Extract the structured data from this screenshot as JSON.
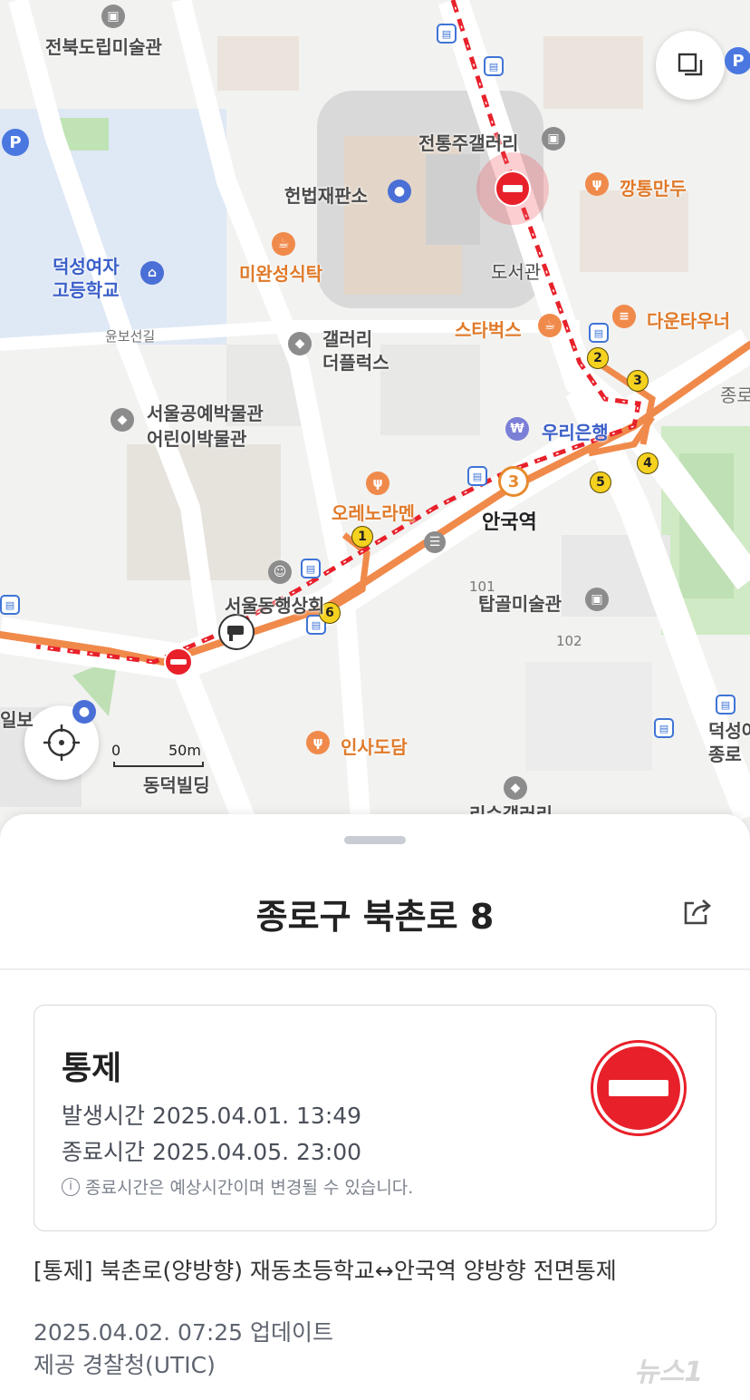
{
  "map": {
    "labels": {
      "museum_jeonbuk": "전북도립미술관",
      "gallery_jeontong": "전통주갤러리",
      "constitutional_court": "헌법재판소",
      "kkangtong": "깡통만두",
      "deoksung_girls_1": "덕성여자",
      "deoksung_girls_2": "고등학교",
      "mianseong": "미완성식탁",
      "library": "도서관",
      "starbucks": "스타벅스",
      "downtowner": "다운타우너",
      "yunboseongil": "윤보선길",
      "gallery_theplux_1": "갤러리",
      "gallery_theplux_2": "더플럭스",
      "jongno_edge": "종로",
      "crafts_museum_1": "서울공예박물관",
      "crafts_museum_2": "어린이박물관",
      "woori_bank": "우리은행",
      "orenora": "오레노라멘",
      "anguk_station": "안국역",
      "n101": "101",
      "tapgol": "탑골미술관",
      "seoul_donghaeng": "서울동행상회",
      "n102": "102",
      "ilbo_edge": "일보",
      "deokseong_edge_1": "덕성여",
      "deokseong_edge_2": "종로",
      "insadodam": "인사도담",
      "dongduk": "동덕빌딩",
      "bottom_gallery": "리수갤러리"
    },
    "scale": {
      "zero": "0",
      "distance": "50m"
    },
    "exits": [
      "1",
      "2",
      "3",
      "4",
      "5",
      "6"
    ],
    "station_line": "3",
    "colors": {
      "closure_red": "#e8202a",
      "detour_orange": "#f08a4b",
      "exit_yellow": "#f5d21f"
    }
  },
  "sheet": {
    "title": "종로구 북촌로 8",
    "status": "통제",
    "start_label": "발생시간",
    "start_time": "2025.04.01. 13:49",
    "end_label": "종료시간",
    "end_time": "2025.04.05. 23:00",
    "note": "종료시간은 예상시간이며 변경될 수 있습니다.",
    "description": "[통제] 북촌로(양방향) 재동초등학교↔안국역 양방향 전면통제",
    "updated": "2025.04.02. 07:25 업데이트",
    "provider": "제공 경찰청(UTIC)",
    "watermark": "뉴스1"
  }
}
